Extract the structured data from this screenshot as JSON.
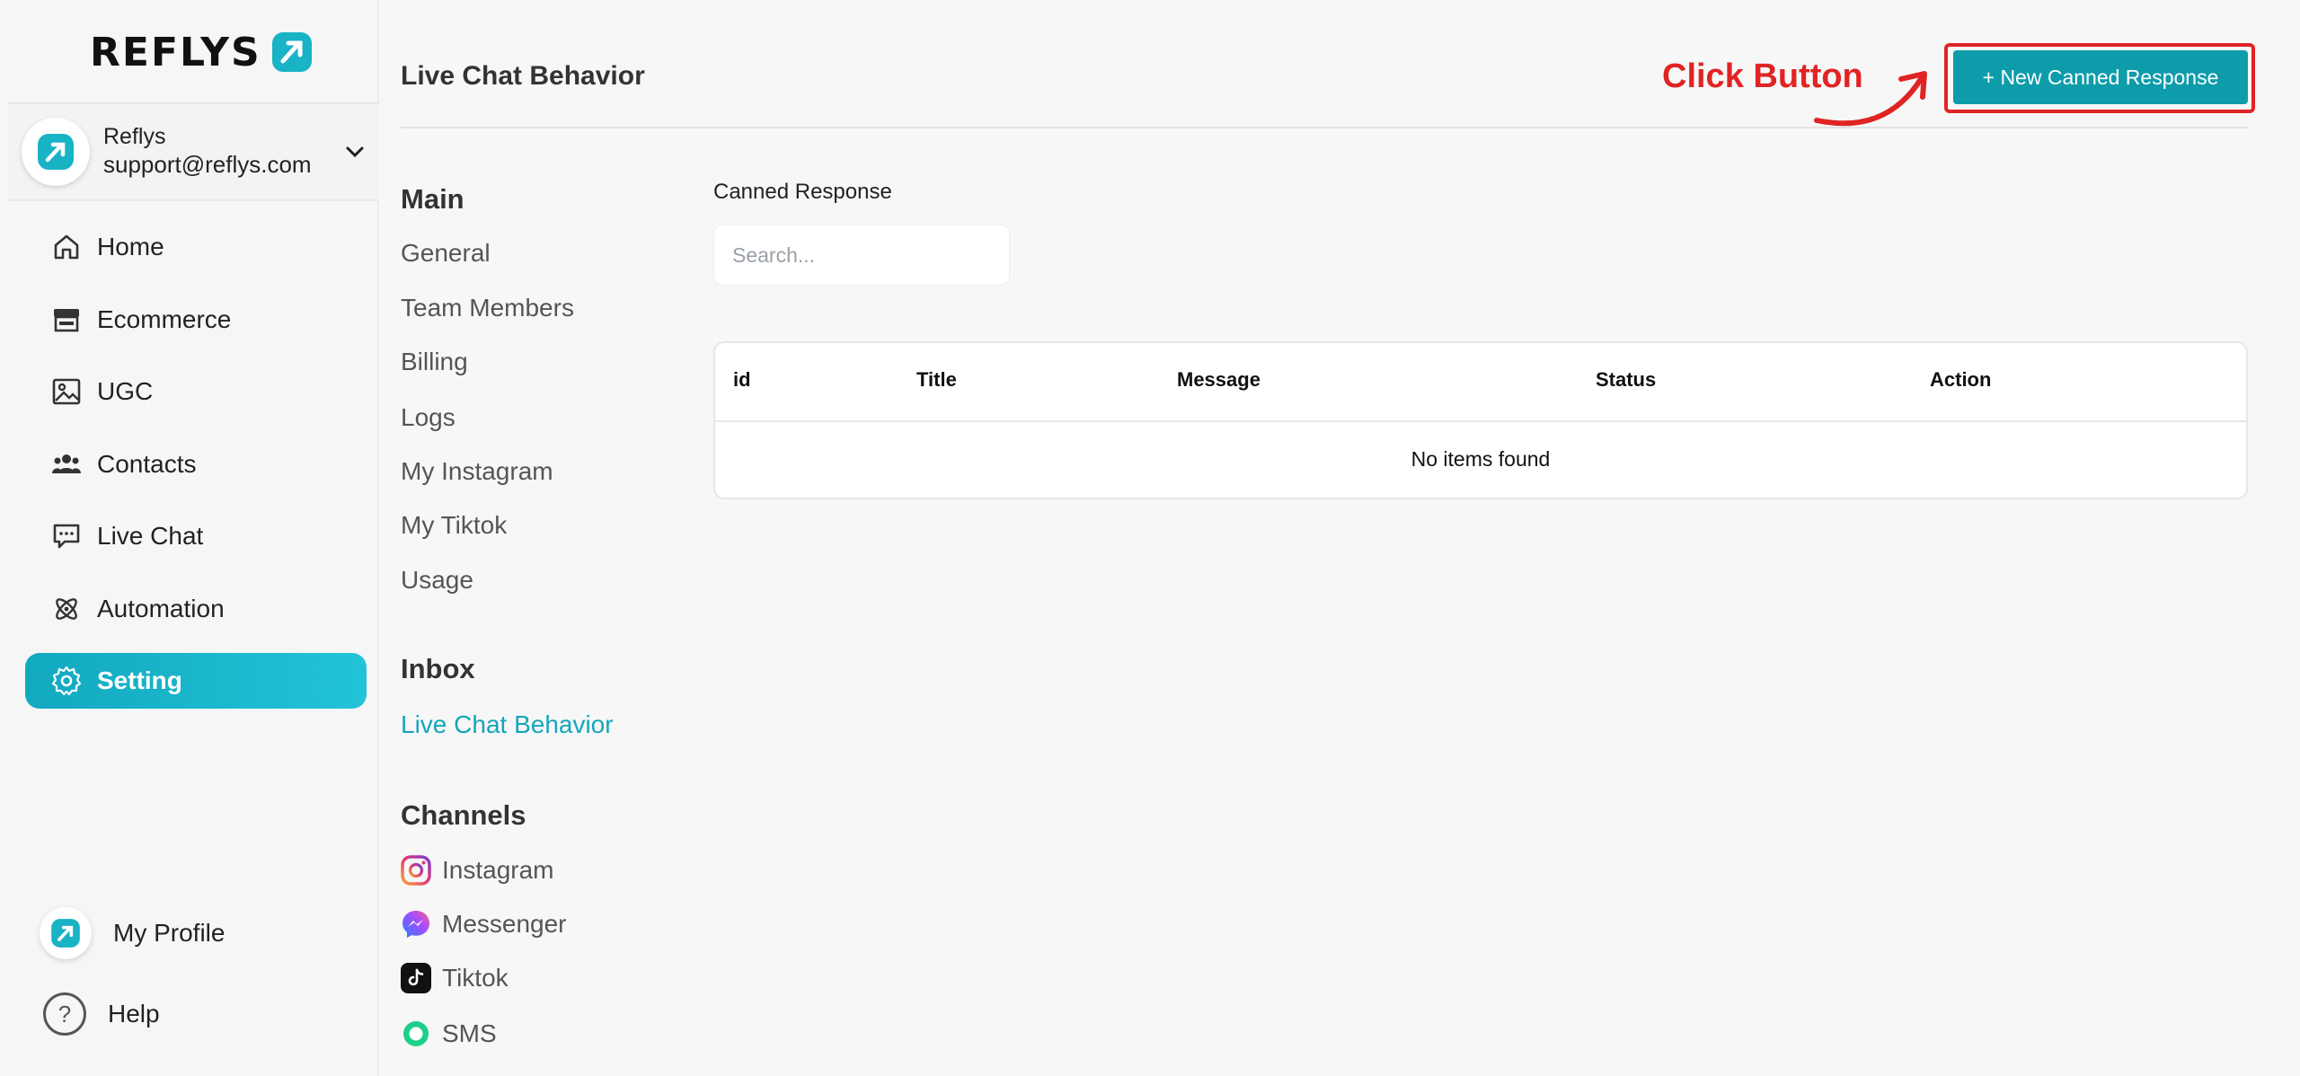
{
  "brand": {
    "name": "REFLYS",
    "accent": "#0e9cab"
  },
  "user": {
    "name": "Reflys",
    "email": "support@reflys.com"
  },
  "nav": {
    "items": [
      {
        "label": "Home",
        "icon": "home-icon"
      },
      {
        "label": "Ecommerce",
        "icon": "store-icon"
      },
      {
        "label": "UGC",
        "icon": "image-icon"
      },
      {
        "label": "Contacts",
        "icon": "users-icon"
      },
      {
        "label": "Live Chat",
        "icon": "chat-icon"
      },
      {
        "label": "Automation",
        "icon": "atom-icon"
      },
      {
        "label": "Setting",
        "icon": "gear-icon",
        "active": true
      }
    ],
    "profile_label": "My Profile",
    "help_label": "Help"
  },
  "header": {
    "title": "Live Chat Behavior",
    "new_button_label": "+ New Canned Response"
  },
  "annotation": {
    "text": "Click Button",
    "color": "#e02424"
  },
  "submenu": {
    "main_heading": "Main",
    "main_items": [
      "General",
      "Team Members",
      "Billing",
      "Logs",
      "My Instagram",
      "My Tiktok",
      "Usage"
    ],
    "inbox_heading": "Inbox",
    "inbox_items": [
      "Live Chat Behavior"
    ],
    "channels_heading": "Channels",
    "channel_items": [
      {
        "label": "Instagram",
        "icon": "instagram-icon"
      },
      {
        "label": "Messenger",
        "icon": "messenger-icon"
      },
      {
        "label": "Tiktok",
        "icon": "tiktok-icon"
      },
      {
        "label": "SMS",
        "icon": "sms-icon"
      }
    ]
  },
  "content": {
    "section_label": "Canned Response",
    "search_placeholder": "Search...",
    "table": {
      "columns": [
        "id",
        "Title",
        "Message",
        "Status",
        "Action"
      ],
      "empty_text": "No items found"
    }
  }
}
